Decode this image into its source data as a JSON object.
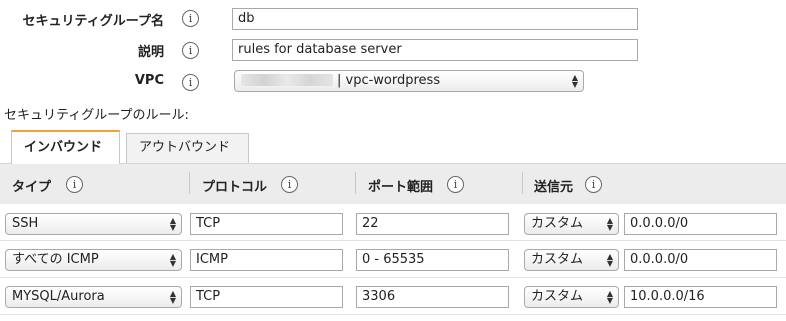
{
  "form": {
    "group_name_label": "セキュリティグループ名",
    "group_name_value": "db",
    "description_label": "説明",
    "description_value": "rules for database server",
    "vpc_label": "VPC",
    "vpc_value": "| vpc-wordpress",
    "info_glyph": "i"
  },
  "rules_title": "セキュリティグループのルール:",
  "tabs": [
    {
      "label": "インバウンド",
      "active": true
    },
    {
      "label": "アウトバウンド",
      "active": false
    }
  ],
  "columns": [
    {
      "label": "タイプ"
    },
    {
      "label": "プロトコル"
    },
    {
      "label": "ポート範囲"
    },
    {
      "label": "送信元"
    }
  ],
  "rows": [
    {
      "type": "SSH",
      "protocol": "TCP",
      "port": "22",
      "source_type": "カスタム",
      "source": "0.0.0.0/0"
    },
    {
      "type": "すべての ICMP",
      "protocol": "ICMP",
      "port": "0 - 65535",
      "source_type": "カスタム",
      "source": "0.0.0.0/0"
    },
    {
      "type": "MYSQL/Aurora",
      "protocol": "TCP",
      "port": "3306",
      "source_type": "カスタム",
      "source": "10.0.0.0/16"
    }
  ],
  "icons": {
    "info": "info-circle-icon",
    "select_arrows": "updown-arrows-icon"
  }
}
